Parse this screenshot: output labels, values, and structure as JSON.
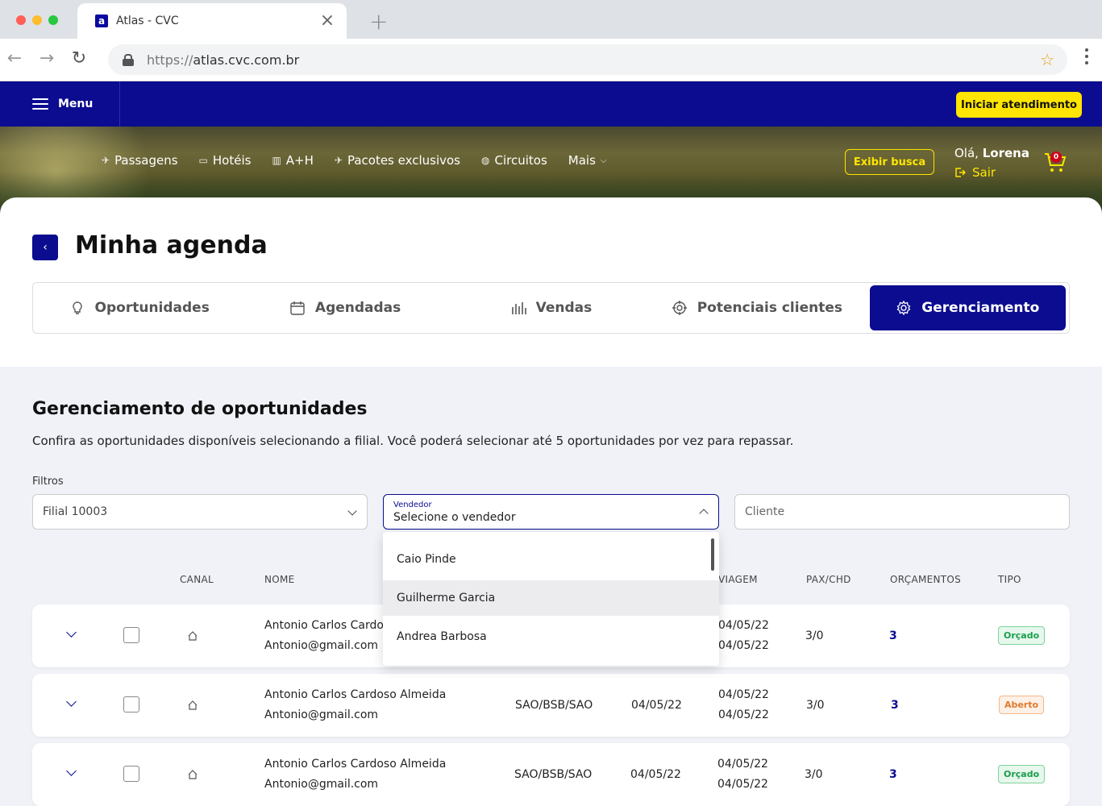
{
  "browser": {
    "tab_title": "Atlas - CVC",
    "favicon_letter": "a",
    "url_protocol": "https://",
    "url_host": "atlas.cvc.com.br"
  },
  "header": {
    "menu_label": "Menu",
    "start_button": "Iniciar atendimento",
    "nav": [
      "Passagens",
      "Hotéis",
      "A+H",
      "Pacotes exclusivos",
      "Circuitos",
      "Mais"
    ],
    "search_button": "Exibir busca",
    "greeting_prefix": "Olá,",
    "user_name": "Lorena",
    "logout": "Sair",
    "cart_count": "0",
    "brand_color": "#0b0c8f",
    "accent_color": "#ffe500"
  },
  "page": {
    "title": "Minha agenda",
    "tabs": [
      "Oportunidades",
      "Agendadas",
      "Vendas",
      "Potenciais clientes",
      "Gerenciamento"
    ],
    "active_tab": "Gerenciamento"
  },
  "section": {
    "title": "Gerenciamento de oportunidades",
    "description": "Confira as oportunidades disponíveis selecionando a filial. Você poderá selecionar até 5 oportunidades por vez para repassar.",
    "filters_label": "Filtros"
  },
  "filters": {
    "branch_value": "Filial 10003",
    "seller_label": "Vendedor",
    "seller_value": "Selecione o vendedor",
    "client_placeholder": "Cliente"
  },
  "dropdown": {
    "options": [
      "Caio Pinde",
      "Guilherme Garcia",
      "Andrea Barbosa"
    ],
    "hovered": "Guilherme Garcia"
  },
  "table": {
    "headers": {
      "canal": "CANAL",
      "nome": "NOME",
      "viagem": "VIAGEM",
      "pax": "PAX/CHD",
      "orcamentos": "ORÇAMENTOS",
      "tipo": "TIPO"
    },
    "rows": [
      {
        "name": "Antonio Carlos Cardoso",
        "email": "Antonio@gmail.com",
        "route": "",
        "date": "",
        "trip_start": "04/05/22",
        "trip_end": "04/05/22",
        "pax": "3/0",
        "quotes": "3",
        "type": "Orçado"
      },
      {
        "name": "Antonio Carlos Cardoso Almeida",
        "email": "Antonio@gmail.com",
        "route": "SAO/BSB/SAO",
        "date": "04/05/22",
        "trip_start": "04/05/22",
        "trip_end": "04/05/22",
        "pax": "3/0",
        "quotes": "3",
        "type": "Aberto"
      },
      {
        "name": "Antonio Carlos Cardoso Almeida",
        "email": "Antonio@gmail.com",
        "route": "SAO/BSB/SAO",
        "date": "04/05/22",
        "trip_start": "04/05/22",
        "trip_end": "04/05/22",
        "pax": "3/0",
        "quotes": "3",
        "type": "Orçado"
      }
    ]
  }
}
